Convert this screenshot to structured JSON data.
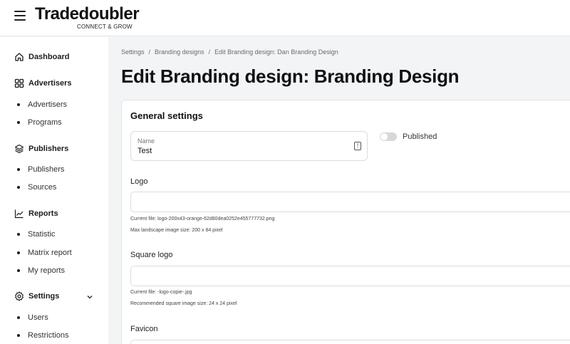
{
  "header": {
    "brand": "Tradedoubler",
    "tagline": "CONNECT & GROW"
  },
  "sidebar": {
    "sections": [
      {
        "label": "Dashboard",
        "icon": "home-icon"
      },
      {
        "label": "Advertisers",
        "icon": "grid-icon",
        "items": [
          "Advertisers",
          "Programs"
        ]
      },
      {
        "label": "Publishers",
        "icon": "layers-icon",
        "items": [
          "Publishers",
          "Sources"
        ]
      },
      {
        "label": "Reports",
        "icon": "chart-icon",
        "items": [
          "Statistic",
          "Matrix report",
          "My reports"
        ]
      },
      {
        "label": "Settings",
        "icon": "gear-icon",
        "expanded": true,
        "items": [
          "Users",
          "Restrictions"
        ]
      }
    ]
  },
  "breadcrumb": [
    "Settings",
    "Branding designs",
    "Edit Branding design: Dan Branding Design"
  ],
  "page_title": "Edit Branding design: Branding Design",
  "form": {
    "section_title": "General settings",
    "name": {
      "label": "Name",
      "value": "Test"
    },
    "published": {
      "label": "Published",
      "checked": false
    },
    "logo": {
      "label": "Logo",
      "current_file": "Current file: logo-200x43-orange-62d80dea0252e455777732.png",
      "hint": "Max landscape image size: 200 x 84 pixel"
    },
    "square_logo": {
      "label": "Square logo",
      "current_file": "Current file: -logo-copie-.jpg",
      "hint": "Recommended square image size: 24 x 24 pixel"
    },
    "favicon": {
      "label": "Favicon"
    }
  }
}
